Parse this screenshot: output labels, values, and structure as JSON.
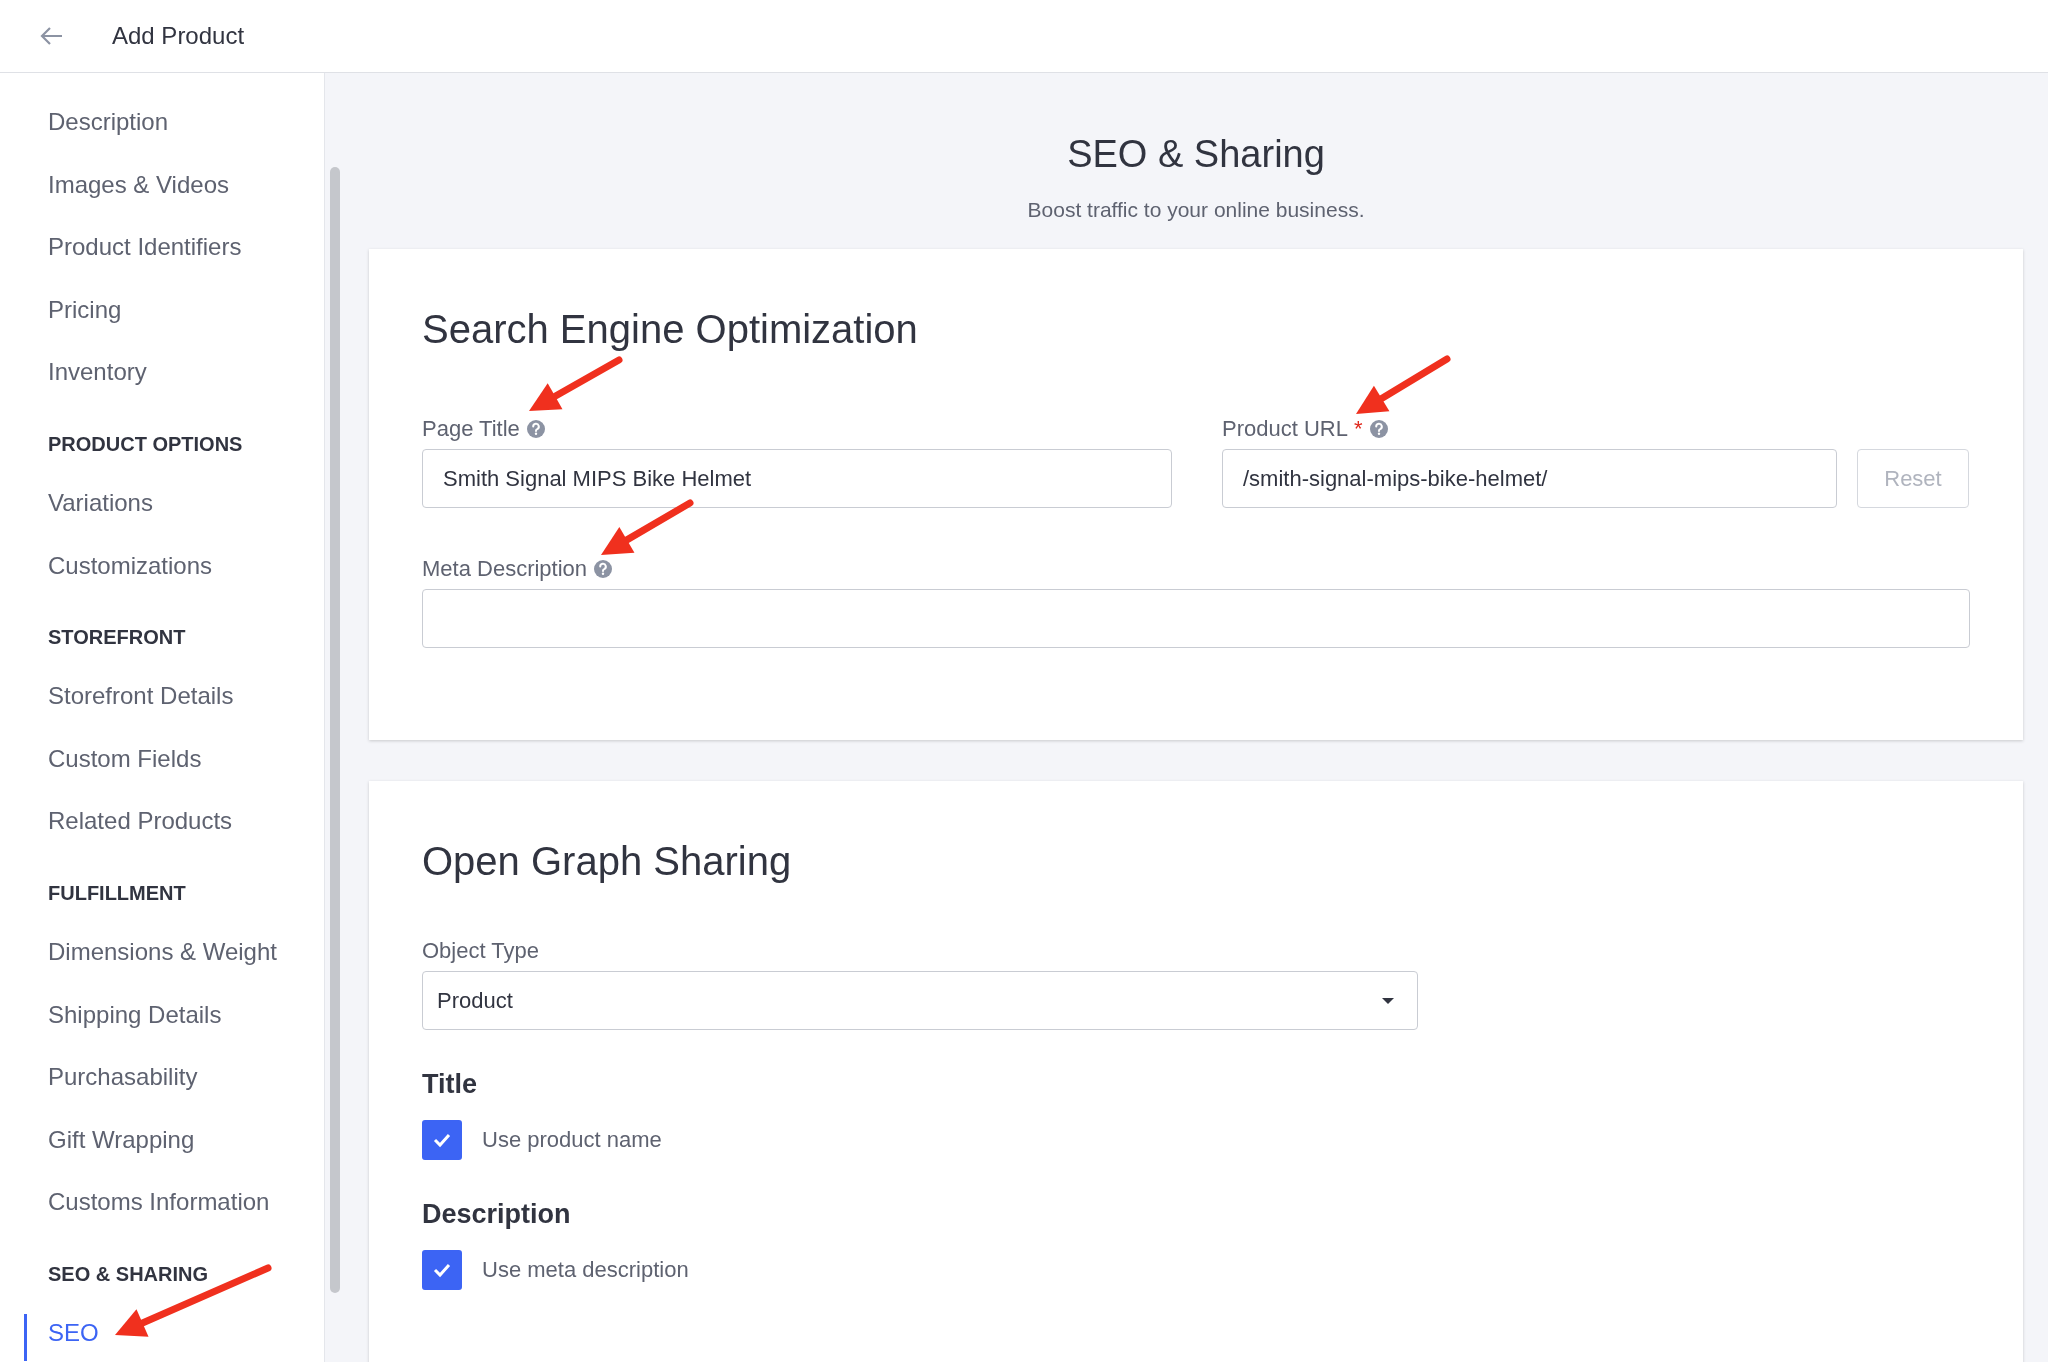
{
  "header": {
    "title": "Add Product"
  },
  "sidebar": {
    "groups": [
      {
        "items": [
          {
            "label": "Description",
            "selected": false
          },
          {
            "label": "Images & Videos",
            "selected": false
          },
          {
            "label": "Product Identifiers",
            "selected": false
          },
          {
            "label": "Pricing",
            "selected": false
          },
          {
            "label": "Inventory",
            "selected": false
          }
        ]
      },
      {
        "heading": "PRODUCT OPTIONS",
        "items": [
          {
            "label": "Variations",
            "selected": false
          },
          {
            "label": "Customizations",
            "selected": false
          }
        ]
      },
      {
        "heading": "STOREFRONT",
        "items": [
          {
            "label": "Storefront Details",
            "selected": false
          },
          {
            "label": "Custom Fields",
            "selected": false
          },
          {
            "label": "Related Products",
            "selected": false
          }
        ]
      },
      {
        "heading": "FULFILLMENT",
        "items": [
          {
            "label": "Dimensions & Weight",
            "selected": false
          },
          {
            "label": "Shipping Details",
            "selected": false
          },
          {
            "label": "Purchasability",
            "selected": false
          },
          {
            "label": "Gift Wrapping",
            "selected": false
          },
          {
            "label": "Customs Information",
            "selected": false
          }
        ]
      },
      {
        "heading": "SEO & SHARING",
        "items": [
          {
            "label": "SEO",
            "selected": true
          }
        ]
      }
    ]
  },
  "page": {
    "title": "SEO & Sharing",
    "subtitle": "Boost traffic to your online business."
  },
  "seo_card": {
    "title": "Search Engine Optimization",
    "page_title": {
      "label": "Page Title",
      "value": "Smith Signal MIPS Bike Helmet"
    },
    "product_url": {
      "label": "Product URL",
      "required_mark": "*",
      "value": "/smith-signal-mips-bike-helmet/"
    },
    "reset_button": {
      "label": "Reset",
      "disabled": true
    },
    "meta_description": {
      "label": "Meta Description"
    }
  },
  "og_card": {
    "title": "Open Graph Sharing",
    "object_type": {
      "label": "Object Type",
      "value": "Product"
    },
    "options": [
      {
        "heading": "Title",
        "label": "Use product name",
        "checked": true
      },
      {
        "heading": "Description",
        "label": "Use meta description",
        "checked": true
      }
    ]
  }
}
